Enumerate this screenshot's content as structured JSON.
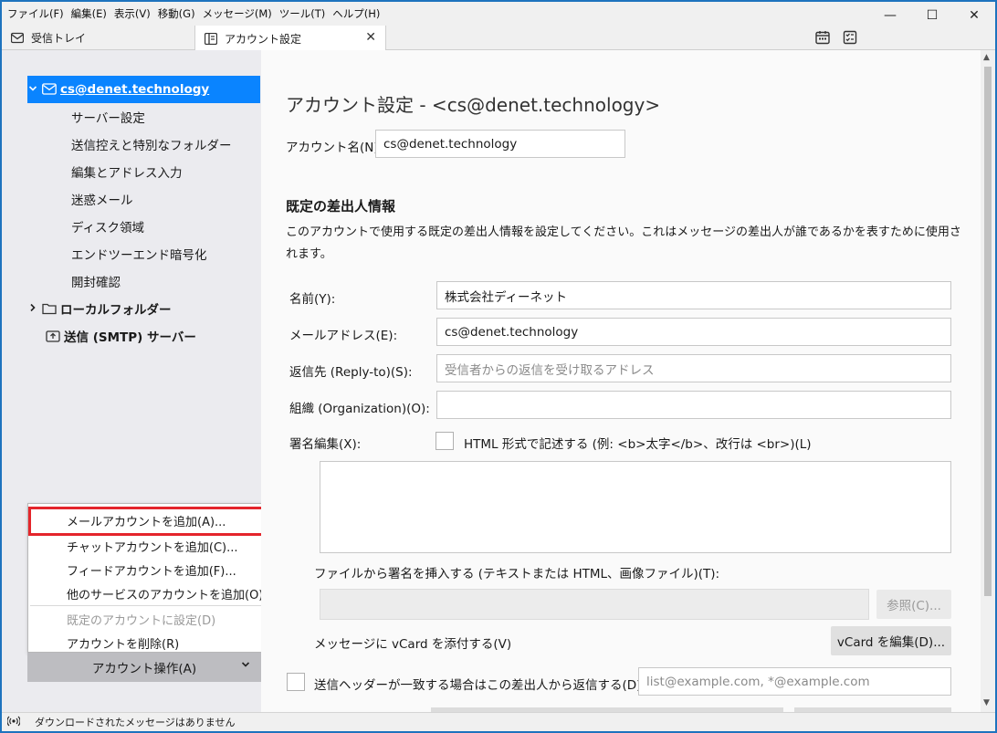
{
  "menubar": {
    "items": [
      "ファイル(F)",
      "編集(E)",
      "表示(V)",
      "移動(G)",
      "メッセージ(M)",
      "ツール(T)",
      "ヘルプ(H)"
    ]
  },
  "window_controls": {
    "minimize": "—",
    "maximize": "☐",
    "close": "✕"
  },
  "tabs": {
    "inbox": "受信トレイ",
    "account_settings": "アカウント設定",
    "close_glyph": "✕"
  },
  "sidebar": {
    "account": "cs@denet.technology",
    "sub_items": [
      "サーバー設定",
      "送信控えと特別なフォルダー",
      "編集とアドレス入力",
      "迷惑メール",
      "ディスク領域",
      "エンドツーエンド暗号化",
      "開封確認"
    ],
    "local_folders": "ローカルフォルダー",
    "smtp": "送信 (SMTP) サーバー",
    "account_actions": "アカウント操作(A)"
  },
  "popup": {
    "items": [
      {
        "label": "メールアカウントを追加(A)...",
        "enabled": true
      },
      {
        "label": "チャットアカウントを追加(C)...",
        "enabled": true
      },
      {
        "label": "フィードアカウントを追加(F)...",
        "enabled": true
      },
      {
        "label": "他のサービスのアカウントを追加(O)...",
        "enabled": true
      },
      {
        "label": "既定のアカウントに設定(D)",
        "enabled": false
      },
      {
        "label": "アカウントを削除(R)",
        "enabled": true
      }
    ],
    "highlight_color": "#e4252b"
  },
  "main": {
    "title": "アカウント設定 - <cs@denet.technology>",
    "account_name_label": "アカウント名(N):",
    "account_name_value": "cs@denet.technology",
    "section_title": "既定の差出人情報",
    "description": "このアカウントで使用する既定の差出人情報を設定してください。これはメッセージの差出人が誰であるかを表すために使用されます。",
    "name_label": "名前(Y):",
    "name_value": "株式会社ディーネット",
    "email_label": "メールアドレス(E):",
    "email_value": "cs@denet.technology",
    "replyto_label": "返信先 (Reply-to)(S):",
    "replyto_placeholder": "受信者からの返信を受け取るアドレス",
    "org_label": "組織 (Organization)(O):",
    "org_value": "",
    "signature_label": "署名編集(X):",
    "html_sig_label": "HTML 形式で記述する (例: <b>太字</b>、改行は <br>)(L)",
    "sig_file_label": "ファイルから署名を挿入する (テキストまたは HTML、画像ファイル)(T):",
    "browse_button": "参照(C)...",
    "vcard_label": "メッセージに vCard を添付する(V)",
    "vcard_button": "vCard を編集(D)...",
    "reply_header_label": "送信ヘッダーが一致する場合はこの差出人から返信する(D):",
    "reply_header_placeholder": "list@example.com, *@example.com"
  },
  "statusbar": {
    "text": "ダウンロードされたメッセージはありません"
  },
  "colors": {
    "accent": "#0a84ff",
    "sidebar_bg": "#ebebef"
  }
}
